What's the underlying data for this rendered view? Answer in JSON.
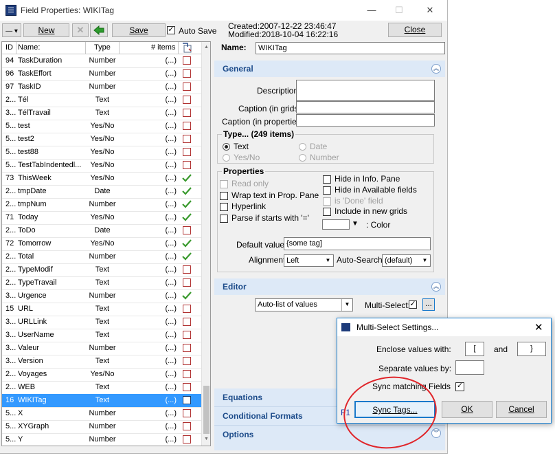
{
  "window": {
    "title": "Field Properties: WIKITag",
    "minimize": "—",
    "maximize": "☐",
    "close": "✕"
  },
  "toolbar": {
    "new_label": "New",
    "save_label": "Save",
    "autosave_label": "Auto Save",
    "created": "Created:2007-12-22 23:46:47",
    "modified": "Modified:2018-10-04 16:22:16",
    "close_label": "Close"
  },
  "grid": {
    "columns": [
      "ID",
      "Name:",
      "Type",
      "# items"
    ],
    "rows": [
      {
        "id": "94",
        "name": "TaskDuration",
        "type": "Number",
        "items": "(...)",
        "mark": "box"
      },
      {
        "id": "96",
        "name": "TaskEffort",
        "type": "Number",
        "items": "(...)",
        "mark": "box"
      },
      {
        "id": "97",
        "name": "TaskID",
        "type": "Number",
        "items": "(...)",
        "mark": "box"
      },
      {
        "id": "2...",
        "name": "Tél",
        "type": "Text",
        "items": "(...)",
        "mark": "box"
      },
      {
        "id": "3...",
        "name": "TélTravail",
        "type": "Text",
        "items": "(...)",
        "mark": "box"
      },
      {
        "id": "5...",
        "name": "test",
        "type": "Yes/No",
        "items": "(...)",
        "mark": "box"
      },
      {
        "id": "5...",
        "name": "test2",
        "type": "Yes/No",
        "items": "(...)",
        "mark": "box"
      },
      {
        "id": "5...",
        "name": "test88",
        "type": "Yes/No",
        "items": "(...)",
        "mark": "box"
      },
      {
        "id": "5...",
        "name": "TestTabIndentedl...",
        "type": "Yes/No",
        "items": "(...)",
        "mark": "box"
      },
      {
        "id": "73",
        "name": "ThisWeek",
        "type": "Yes/No",
        "items": "(...)",
        "mark": "check"
      },
      {
        "id": "2...",
        "name": "tmpDate",
        "type": "Date",
        "items": "(...)",
        "mark": "check"
      },
      {
        "id": "2...",
        "name": "tmpNum",
        "type": "Number",
        "items": "(...)",
        "mark": "check"
      },
      {
        "id": "71",
        "name": "Today",
        "type": "Yes/No",
        "items": "(...)",
        "mark": "check"
      },
      {
        "id": "2...",
        "name": "ToDo",
        "type": "Date",
        "items": "(...)",
        "mark": "box"
      },
      {
        "id": "72",
        "name": "Tomorrow",
        "type": "Yes/No",
        "items": "(...)",
        "mark": "check"
      },
      {
        "id": "2...",
        "name": "Total",
        "type": "Number",
        "items": "(...)",
        "mark": "check"
      },
      {
        "id": "2...",
        "name": "TypeModif",
        "type": "Text",
        "items": "(...)",
        "mark": "box"
      },
      {
        "id": "2...",
        "name": "TypeTravail",
        "type": "Text",
        "items": "(...)",
        "mark": "box"
      },
      {
        "id": "3...",
        "name": "Urgence",
        "type": "Number",
        "items": "(...)",
        "mark": "check"
      },
      {
        "id": "15",
        "name": "URL",
        "type": "Text",
        "items": "(...)",
        "mark": "box"
      },
      {
        "id": "3...",
        "name": "URLLink",
        "type": "Text",
        "items": "(...)",
        "mark": "box"
      },
      {
        "id": "3...",
        "name": "UserName",
        "type": "Text",
        "items": "(...)",
        "mark": "box"
      },
      {
        "id": "3...",
        "name": "Valeur",
        "type": "Number",
        "items": "(...)",
        "mark": "box"
      },
      {
        "id": "3...",
        "name": "Version",
        "type": "Text",
        "items": "(...)",
        "mark": "box"
      },
      {
        "id": "2...",
        "name": "Voyages",
        "type": "Yes/No",
        "items": "(...)",
        "mark": "box"
      },
      {
        "id": "2...",
        "name": "WEB",
        "type": "Text",
        "items": "(...)",
        "mark": "box"
      },
      {
        "id": "16",
        "name": "WIKITag",
        "type": "Text",
        "items": "(...)",
        "mark": "box",
        "selected": true
      },
      {
        "id": "5...",
        "name": "X",
        "type": "Number",
        "items": "(...)",
        "mark": "box"
      },
      {
        "id": "5...",
        "name": "XYGraph",
        "type": "Number",
        "items": "(...)",
        "mark": "box"
      },
      {
        "id": "5...",
        "name": "Y",
        "type": "Number",
        "items": "(...)",
        "mark": "box"
      }
    ]
  },
  "props": {
    "name_label": "Name:",
    "name_value": "WIKITag",
    "general_title": "General",
    "description_label": "Description",
    "caption_grids_label": "Caption (in grids):",
    "caption_props_label": "Caption (in properties):",
    "type_legend": "Type...  (249 items)",
    "type_text": "Text",
    "type_yesno": "Yes/No",
    "type_date": "Date",
    "type_number": "Number",
    "properties_legend": "Properties",
    "read_only": "Read only",
    "wrap_text": "Wrap text in Prop. Pane",
    "hyperlink": "Hyperlink",
    "parse_if": "Parse if starts with '='",
    "hide_info": "Hide in Info. Pane",
    "hide_available": "Hide in Available fields",
    "is_done": "is 'Done' field",
    "include_grids": "Include in new grids",
    "color_label": ": Color",
    "default_value_label": "Default value:",
    "default_value": "{some tag]",
    "alignment_label": "Alignment",
    "alignment_value": "Left",
    "autosearch_label": "Auto-Search:",
    "autosearch_value": "(default)",
    "editor_title": "Editor",
    "editor_value": "Auto-list of values",
    "multiselect_label": "Multi-Select:",
    "ellipsis": "...",
    "equations_title": "Equations",
    "conditional_title": "Conditional Formats",
    "options_title": "Options"
  },
  "dialog": {
    "title": "Multi-Select Settings...",
    "enclose_label": "Enclose values with:",
    "enclose_open": "[",
    "and_label": "and",
    "enclose_close": "}",
    "separate_label": "Separate values by:",
    "separate_value": "",
    "sync_fields_label": "Sync matching Fields",
    "f1_label": "F1",
    "sync_tags_label": "Sync Tags...",
    "ok_label": "OK",
    "cancel_label": "Cancel"
  },
  "colors": {
    "section_bg": "#dde9f7",
    "section_text": "#1c4b8a",
    "selection": "#3399ff",
    "check_green": "#3a9a2e",
    "annotation_red": "#e0252a"
  }
}
